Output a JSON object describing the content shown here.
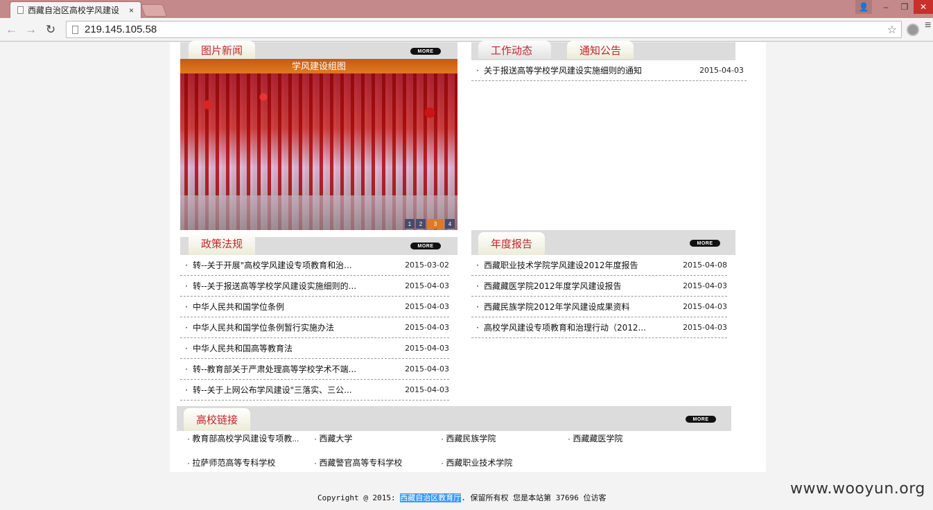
{
  "browser": {
    "tab_title": "西藏自治区高校学风建设",
    "tab_close": "×",
    "url": "219.145.105.58",
    "nav_back": "←",
    "nav_forward": "→",
    "nav_reload": "↻",
    "bookmark_star": "☆",
    "win_user": "👤",
    "win_minimize": "–",
    "win_maximize": "❐",
    "win_close": "✕"
  },
  "more_label": "MORE",
  "photo_news": {
    "title": "图片新闻",
    "caption": "学风建设组图",
    "pager": [
      "1",
      "2",
      "3",
      "4"
    ],
    "pager_active": 2
  },
  "work_news": {
    "tab_work": "工作动态",
    "tab_notice": "通知公告",
    "items": [
      {
        "text": "关于报送高等学校学风建设实施细则的通知",
        "date": "2015-04-03"
      }
    ]
  },
  "policy": {
    "title": "政策法规",
    "items": [
      {
        "text": "转--关于开展\"高校学风建设专项教育和治...",
        "date": "2015-03-02"
      },
      {
        "text": "转--关于报送高等学校学风建设实施细则的...",
        "date": "2015-04-03"
      },
      {
        "text": "中华人民共和国学位条例",
        "date": "2015-04-03"
      },
      {
        "text": "中华人民共和国学位条例暂行实施办法",
        "date": "2015-04-03"
      },
      {
        "text": "中华人民共和国高等教育法",
        "date": "2015-04-03"
      },
      {
        "text": "转--教育部关于严肃处理高等学校学术不端...",
        "date": "2015-04-03"
      },
      {
        "text": "转--关于上网公布学风建设\"三落实、三公...",
        "date": "2015-04-03"
      }
    ]
  },
  "annual": {
    "title": "年度报告",
    "items": [
      {
        "text": "西藏职业技术学院学风建设2012年度报告",
        "date": "2015-04-08"
      },
      {
        "text": "西藏藏医学院2012年度学风建设报告",
        "date": "2015-04-03"
      },
      {
        "text": "西藏民族学院2012年学风建设成果资料",
        "date": "2015-04-03"
      },
      {
        "text": "高校学风建设专项教育和治理行动（2012...",
        "date": "2015-04-03"
      }
    ]
  },
  "links": {
    "title": "高校链接",
    "items": [
      "教育部高校学风建设专项教...",
      "西藏大学",
      "西藏民族学院",
      "西藏藏医学院",
      "拉萨师范高等专科学校",
      "西藏警官高等专科学校",
      "西藏职业技术学院"
    ]
  },
  "footer": {
    "prefix": "Copyright @ 2015:",
    "org": "西藏自治区教育厅",
    "suffix": ". 保留所有权   您是本站第 37696 位访客"
  },
  "watermark": "www.wooyun.org"
}
